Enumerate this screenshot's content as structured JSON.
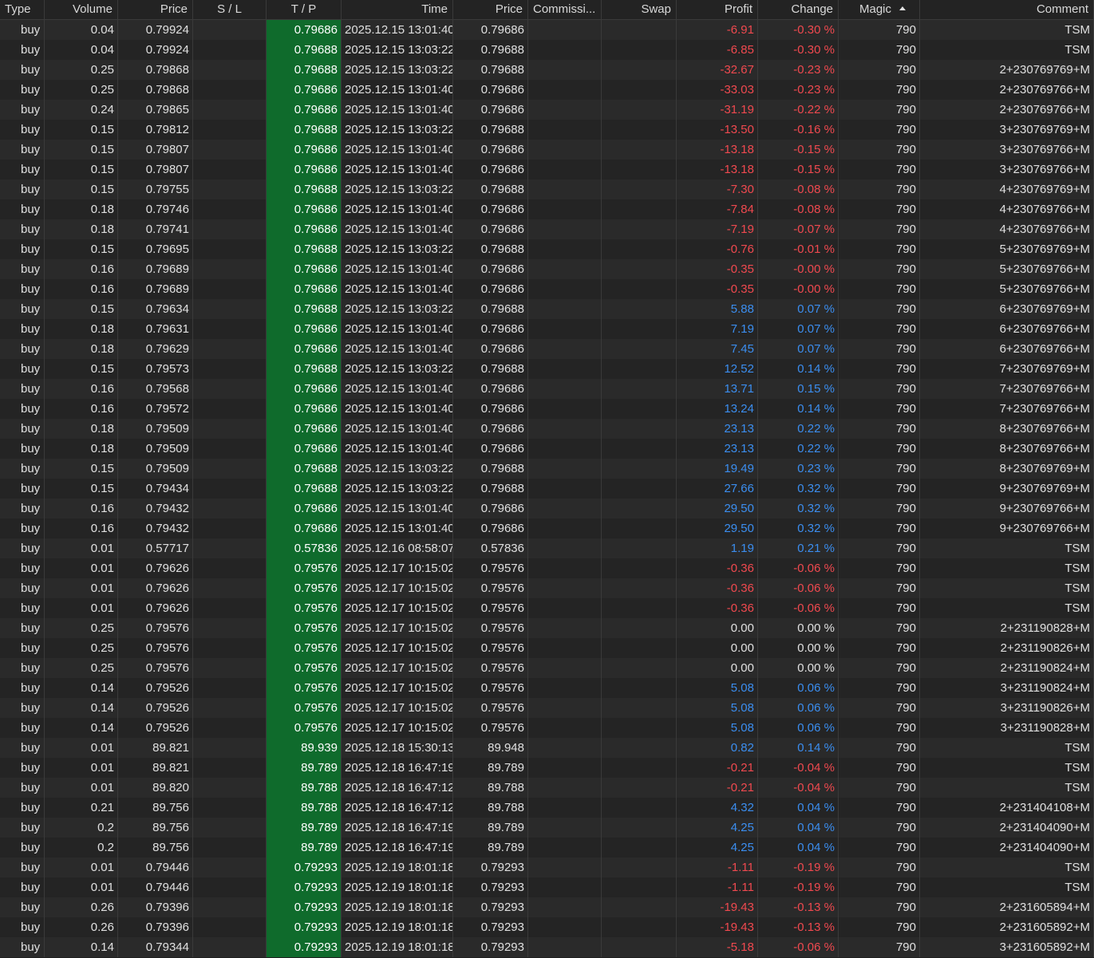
{
  "columns": [
    "Type",
    "Volume",
    "Price",
    "S / L",
    "T / P",
    "Time",
    "Price",
    "Commissi...",
    "Swap",
    "Profit",
    "Change",
    "Magic",
    "Comment"
  ],
  "rows": [
    {
      "type": "buy",
      "volume": "0.04",
      "price": "0.79924",
      "sl": "",
      "tp": "0.79686",
      "time": "2025.12.15 13:01:40",
      "cur": "0.79686",
      "comm": "",
      "swap": "",
      "profit": "-6.91",
      "change": "-0.30 %",
      "magic": "790",
      "comment": "TSM"
    },
    {
      "type": "buy",
      "volume": "0.04",
      "price": "0.79924",
      "sl": "",
      "tp": "0.79688",
      "time": "2025.12.15 13:03:22",
      "cur": "0.79688",
      "comm": "",
      "swap": "",
      "profit": "-6.85",
      "change": "-0.30 %",
      "magic": "790",
      "comment": "TSM"
    },
    {
      "type": "buy",
      "volume": "0.25",
      "price": "0.79868",
      "sl": "",
      "tp": "0.79688",
      "time": "2025.12.15 13:03:22",
      "cur": "0.79688",
      "comm": "",
      "swap": "",
      "profit": "-32.67",
      "change": "-0.23 %",
      "magic": "790",
      "comment": "2+230769769+M"
    },
    {
      "type": "buy",
      "volume": "0.25",
      "price": "0.79868",
      "sl": "",
      "tp": "0.79686",
      "time": "2025.12.15 13:01:40",
      "cur": "0.79686",
      "comm": "",
      "swap": "",
      "profit": "-33.03",
      "change": "-0.23 %",
      "magic": "790",
      "comment": "2+230769766+M"
    },
    {
      "type": "buy",
      "volume": "0.24",
      "price": "0.79865",
      "sl": "",
      "tp": "0.79686",
      "time": "2025.12.15 13:01:40",
      "cur": "0.79686",
      "comm": "",
      "swap": "",
      "profit": "-31.19",
      "change": "-0.22 %",
      "magic": "790",
      "comment": "2+230769766+M"
    },
    {
      "type": "buy",
      "volume": "0.15",
      "price": "0.79812",
      "sl": "",
      "tp": "0.79688",
      "time": "2025.12.15 13:03:22",
      "cur": "0.79688",
      "comm": "",
      "swap": "",
      "profit": "-13.50",
      "change": "-0.16 %",
      "magic": "790",
      "comment": "3+230769769+M"
    },
    {
      "type": "buy",
      "volume": "0.15",
      "price": "0.79807",
      "sl": "",
      "tp": "0.79686",
      "time": "2025.12.15 13:01:40",
      "cur": "0.79686",
      "comm": "",
      "swap": "",
      "profit": "-13.18",
      "change": "-0.15 %",
      "magic": "790",
      "comment": "3+230769766+M"
    },
    {
      "type": "buy",
      "volume": "0.15",
      "price": "0.79807",
      "sl": "",
      "tp": "0.79686",
      "time": "2025.12.15 13:01:40",
      "cur": "0.79686",
      "comm": "",
      "swap": "",
      "profit": "-13.18",
      "change": "-0.15 %",
      "magic": "790",
      "comment": "3+230769766+M"
    },
    {
      "type": "buy",
      "volume": "0.15",
      "price": "0.79755",
      "sl": "",
      "tp": "0.79688",
      "time": "2025.12.15 13:03:22",
      "cur": "0.79688",
      "comm": "",
      "swap": "",
      "profit": "-7.30",
      "change": "-0.08 %",
      "magic": "790",
      "comment": "4+230769769+M"
    },
    {
      "type": "buy",
      "volume": "0.18",
      "price": "0.79746",
      "sl": "",
      "tp": "0.79686",
      "time": "2025.12.15 13:01:40",
      "cur": "0.79686",
      "comm": "",
      "swap": "",
      "profit": "-7.84",
      "change": "-0.08 %",
      "magic": "790",
      "comment": "4+230769766+M"
    },
    {
      "type": "buy",
      "volume": "0.18",
      "price": "0.79741",
      "sl": "",
      "tp": "0.79686",
      "time": "2025.12.15 13:01:40",
      "cur": "0.79686",
      "comm": "",
      "swap": "",
      "profit": "-7.19",
      "change": "-0.07 %",
      "magic": "790",
      "comment": "4+230769766+M"
    },
    {
      "type": "buy",
      "volume": "0.15",
      "price": "0.79695",
      "sl": "",
      "tp": "0.79688",
      "time": "2025.12.15 13:03:22",
      "cur": "0.79688",
      "comm": "",
      "swap": "",
      "profit": "-0.76",
      "change": "-0.01 %",
      "magic": "790",
      "comment": "5+230769769+M"
    },
    {
      "type": "buy",
      "volume": "0.16",
      "price": "0.79689",
      "sl": "",
      "tp": "0.79686",
      "time": "2025.12.15 13:01:40",
      "cur": "0.79686",
      "comm": "",
      "swap": "",
      "profit": "-0.35",
      "change": "-0.00 %",
      "magic": "790",
      "comment": "5+230769766+M"
    },
    {
      "type": "buy",
      "volume": "0.16",
      "price": "0.79689",
      "sl": "",
      "tp": "0.79686",
      "time": "2025.12.15 13:01:40",
      "cur": "0.79686",
      "comm": "",
      "swap": "",
      "profit": "-0.35",
      "change": "-0.00 %",
      "magic": "790",
      "comment": "5+230769766+M"
    },
    {
      "type": "buy",
      "volume": "0.15",
      "price": "0.79634",
      "sl": "",
      "tp": "0.79688",
      "time": "2025.12.15 13:03:22",
      "cur": "0.79688",
      "comm": "",
      "swap": "",
      "profit": "5.88",
      "change": "0.07 %",
      "magic": "790",
      "comment": "6+230769769+M"
    },
    {
      "type": "buy",
      "volume": "0.18",
      "price": "0.79631",
      "sl": "",
      "tp": "0.79686",
      "time": "2025.12.15 13:01:40",
      "cur": "0.79686",
      "comm": "",
      "swap": "",
      "profit": "7.19",
      "change": "0.07 %",
      "magic": "790",
      "comment": "6+230769766+M"
    },
    {
      "type": "buy",
      "volume": "0.18",
      "price": "0.79629",
      "sl": "",
      "tp": "0.79686",
      "time": "2025.12.15 13:01:40",
      "cur": "0.79686",
      "comm": "",
      "swap": "",
      "profit": "7.45",
      "change": "0.07 %",
      "magic": "790",
      "comment": "6+230769766+M"
    },
    {
      "type": "buy",
      "volume": "0.15",
      "price": "0.79573",
      "sl": "",
      "tp": "0.79688",
      "time": "2025.12.15 13:03:22",
      "cur": "0.79688",
      "comm": "",
      "swap": "",
      "profit": "12.52",
      "change": "0.14 %",
      "magic": "790",
      "comment": "7+230769769+M"
    },
    {
      "type": "buy",
      "volume": "0.16",
      "price": "0.79568",
      "sl": "",
      "tp": "0.79686",
      "time": "2025.12.15 13:01:40",
      "cur": "0.79686",
      "comm": "",
      "swap": "",
      "profit": "13.71",
      "change": "0.15 %",
      "magic": "790",
      "comment": "7+230769766+M"
    },
    {
      "type": "buy",
      "volume": "0.16",
      "price": "0.79572",
      "sl": "",
      "tp": "0.79686",
      "time": "2025.12.15 13:01:40",
      "cur": "0.79686",
      "comm": "",
      "swap": "",
      "profit": "13.24",
      "change": "0.14 %",
      "magic": "790",
      "comment": "7+230769766+M"
    },
    {
      "type": "buy",
      "volume": "0.18",
      "price": "0.79509",
      "sl": "",
      "tp": "0.79686",
      "time": "2025.12.15 13:01:40",
      "cur": "0.79686",
      "comm": "",
      "swap": "",
      "profit": "23.13",
      "change": "0.22 %",
      "magic": "790",
      "comment": "8+230769766+M"
    },
    {
      "type": "buy",
      "volume": "0.18",
      "price": "0.79509",
      "sl": "",
      "tp": "0.79686",
      "time": "2025.12.15 13:01:40",
      "cur": "0.79686",
      "comm": "",
      "swap": "",
      "profit": "23.13",
      "change": "0.22 %",
      "magic": "790",
      "comment": "8+230769766+M"
    },
    {
      "type": "buy",
      "volume": "0.15",
      "price": "0.79509",
      "sl": "",
      "tp": "0.79688",
      "time": "2025.12.15 13:03:22",
      "cur": "0.79688",
      "comm": "",
      "swap": "",
      "profit": "19.49",
      "change": "0.23 %",
      "magic": "790",
      "comment": "8+230769769+M"
    },
    {
      "type": "buy",
      "volume": "0.15",
      "price": "0.79434",
      "sl": "",
      "tp": "0.79688",
      "time": "2025.12.15 13:03:22",
      "cur": "0.79688",
      "comm": "",
      "swap": "",
      "profit": "27.66",
      "change": "0.32 %",
      "magic": "790",
      "comment": "9+230769769+M"
    },
    {
      "type": "buy",
      "volume": "0.16",
      "price": "0.79432",
      "sl": "",
      "tp": "0.79686",
      "time": "2025.12.15 13:01:40",
      "cur": "0.79686",
      "comm": "",
      "swap": "",
      "profit": "29.50",
      "change": "0.32 %",
      "magic": "790",
      "comment": "9+230769766+M"
    },
    {
      "type": "buy",
      "volume": "0.16",
      "price": "0.79432",
      "sl": "",
      "tp": "0.79686",
      "time": "2025.12.15 13:01:40",
      "cur": "0.79686",
      "comm": "",
      "swap": "",
      "profit": "29.50",
      "change": "0.32 %",
      "magic": "790",
      "comment": "9+230769766+M"
    },
    {
      "type": "buy",
      "volume": "0.01",
      "price": "0.57717",
      "sl": "",
      "tp": "0.57836",
      "time": "2025.12.16 08:58:07",
      "cur": "0.57836",
      "comm": "",
      "swap": "",
      "profit": "1.19",
      "change": "0.21 %",
      "magic": "790",
      "comment": "TSM"
    },
    {
      "type": "buy",
      "volume": "0.01",
      "price": "0.79626",
      "sl": "",
      "tp": "0.79576",
      "time": "2025.12.17 10:15:02",
      "cur": "0.79576",
      "comm": "",
      "swap": "",
      "profit": "-0.36",
      "change": "-0.06 %",
      "magic": "790",
      "comment": "TSM"
    },
    {
      "type": "buy",
      "volume": "0.01",
      "price": "0.79626",
      "sl": "",
      "tp": "0.79576",
      "time": "2025.12.17 10:15:02",
      "cur": "0.79576",
      "comm": "",
      "swap": "",
      "profit": "-0.36",
      "change": "-0.06 %",
      "magic": "790",
      "comment": "TSM"
    },
    {
      "type": "buy",
      "volume": "0.01",
      "price": "0.79626",
      "sl": "",
      "tp": "0.79576",
      "time": "2025.12.17 10:15:02",
      "cur": "0.79576",
      "comm": "",
      "swap": "",
      "profit": "-0.36",
      "change": "-0.06 %",
      "magic": "790",
      "comment": "TSM"
    },
    {
      "type": "buy",
      "volume": "0.25",
      "price": "0.79576",
      "sl": "",
      "tp": "0.79576",
      "time": "2025.12.17 10:15:02",
      "cur": "0.79576",
      "comm": "",
      "swap": "",
      "profit": "0.00",
      "change": "0.00 %",
      "magic": "790",
      "comment": "2+231190828+M"
    },
    {
      "type": "buy",
      "volume": "0.25",
      "price": "0.79576",
      "sl": "",
      "tp": "0.79576",
      "time": "2025.12.17 10:15:02",
      "cur": "0.79576",
      "comm": "",
      "swap": "",
      "profit": "0.00",
      "change": "0.00 %",
      "magic": "790",
      "comment": "2+231190826+M"
    },
    {
      "type": "buy",
      "volume": "0.25",
      "price": "0.79576",
      "sl": "",
      "tp": "0.79576",
      "time": "2025.12.17 10:15:02",
      "cur": "0.79576",
      "comm": "",
      "swap": "",
      "profit": "0.00",
      "change": "0.00 %",
      "magic": "790",
      "comment": "2+231190824+M"
    },
    {
      "type": "buy",
      "volume": "0.14",
      "price": "0.79526",
      "sl": "",
      "tp": "0.79576",
      "time": "2025.12.17 10:15:02",
      "cur": "0.79576",
      "comm": "",
      "swap": "",
      "profit": "5.08",
      "change": "0.06 %",
      "magic": "790",
      "comment": "3+231190824+M"
    },
    {
      "type": "buy",
      "volume": "0.14",
      "price": "0.79526",
      "sl": "",
      "tp": "0.79576",
      "time": "2025.12.17 10:15:02",
      "cur": "0.79576",
      "comm": "",
      "swap": "",
      "profit": "5.08",
      "change": "0.06 %",
      "magic": "790",
      "comment": "3+231190826+M"
    },
    {
      "type": "buy",
      "volume": "0.14",
      "price": "0.79526",
      "sl": "",
      "tp": "0.79576",
      "time": "2025.12.17 10:15:02",
      "cur": "0.79576",
      "comm": "",
      "swap": "",
      "profit": "5.08",
      "change": "0.06 %",
      "magic": "790",
      "comment": "3+231190828+M"
    },
    {
      "type": "buy",
      "volume": "0.01",
      "price": "89.821",
      "sl": "",
      "tp": "89.939",
      "time": "2025.12.18 15:30:13",
      "cur": "89.948",
      "comm": "",
      "swap": "",
      "profit": "0.82",
      "change": "0.14 %",
      "magic": "790",
      "comment": "TSM"
    },
    {
      "type": "buy",
      "volume": "0.01",
      "price": "89.821",
      "sl": "",
      "tp": "89.789",
      "time": "2025.12.18 16:47:19",
      "cur": "89.789",
      "comm": "",
      "swap": "",
      "profit": "-0.21",
      "change": "-0.04 %",
      "magic": "790",
      "comment": "TSM"
    },
    {
      "type": "buy",
      "volume": "0.01",
      "price": "89.820",
      "sl": "",
      "tp": "89.788",
      "time": "2025.12.18 16:47:12",
      "cur": "89.788",
      "comm": "",
      "swap": "",
      "profit": "-0.21",
      "change": "-0.04 %",
      "magic": "790",
      "comment": "TSM"
    },
    {
      "type": "buy",
      "volume": "0.21",
      "price": "89.756",
      "sl": "",
      "tp": "89.788",
      "time": "2025.12.18 16:47:12",
      "cur": "89.788",
      "comm": "",
      "swap": "",
      "profit": "4.32",
      "change": "0.04 %",
      "magic": "790",
      "comment": "2+231404108+M"
    },
    {
      "type": "buy",
      "volume": "0.2",
      "price": "89.756",
      "sl": "",
      "tp": "89.789",
      "time": "2025.12.18 16:47:19",
      "cur": "89.789",
      "comm": "",
      "swap": "",
      "profit": "4.25",
      "change": "0.04 %",
      "magic": "790",
      "comment": "2+231404090+M"
    },
    {
      "type": "buy",
      "volume": "0.2",
      "price": "89.756",
      "sl": "",
      "tp": "89.789",
      "time": "2025.12.18 16:47:19",
      "cur": "89.789",
      "comm": "",
      "swap": "",
      "profit": "4.25",
      "change": "0.04 %",
      "magic": "790",
      "comment": "2+231404090+M"
    },
    {
      "type": "buy",
      "volume": "0.01",
      "price": "0.79446",
      "sl": "",
      "tp": "0.79293",
      "time": "2025.12.19 18:01:18",
      "cur": "0.79293",
      "comm": "",
      "swap": "",
      "profit": "-1.11",
      "change": "-0.19 %",
      "magic": "790",
      "comment": "TSM"
    },
    {
      "type": "buy",
      "volume": "0.01",
      "price": "0.79446",
      "sl": "",
      "tp": "0.79293",
      "time": "2025.12.19 18:01:18",
      "cur": "0.79293",
      "comm": "",
      "swap": "",
      "profit": "-1.11",
      "change": "-0.19 %",
      "magic": "790",
      "comment": "TSM"
    },
    {
      "type": "buy",
      "volume": "0.26",
      "price": "0.79396",
      "sl": "",
      "tp": "0.79293",
      "time": "2025.12.19 18:01:18",
      "cur": "0.79293",
      "comm": "",
      "swap": "",
      "profit": "-19.43",
      "change": "-0.13 %",
      "magic": "790",
      "comment": "2+231605894+M"
    },
    {
      "type": "buy",
      "volume": "0.26",
      "price": "0.79396",
      "sl": "",
      "tp": "0.79293",
      "time": "2025.12.19 18:01:18",
      "cur": "0.79293",
      "comm": "",
      "swap": "",
      "profit": "-19.43",
      "change": "-0.13 %",
      "magic": "790",
      "comment": "2+231605892+M"
    },
    {
      "type": "buy",
      "volume": "0.14",
      "price": "0.79344",
      "sl": "",
      "tp": "0.79293",
      "time": "2025.12.19 18:01:18",
      "cur": "0.79293",
      "comm": "",
      "swap": "",
      "profit": "-5.18",
      "change": "-0.06 %",
      "magic": "790",
      "comment": "3+231605892+M"
    }
  ],
  "sort": {
    "column": "Magic",
    "direction": "ascending",
    "icon": "sort-ascending-icon"
  },
  "colors": {
    "tp_bg": "#0f6b2c",
    "profit_pos": "#3b8ef0",
    "profit_neg": "#f0494f"
  }
}
